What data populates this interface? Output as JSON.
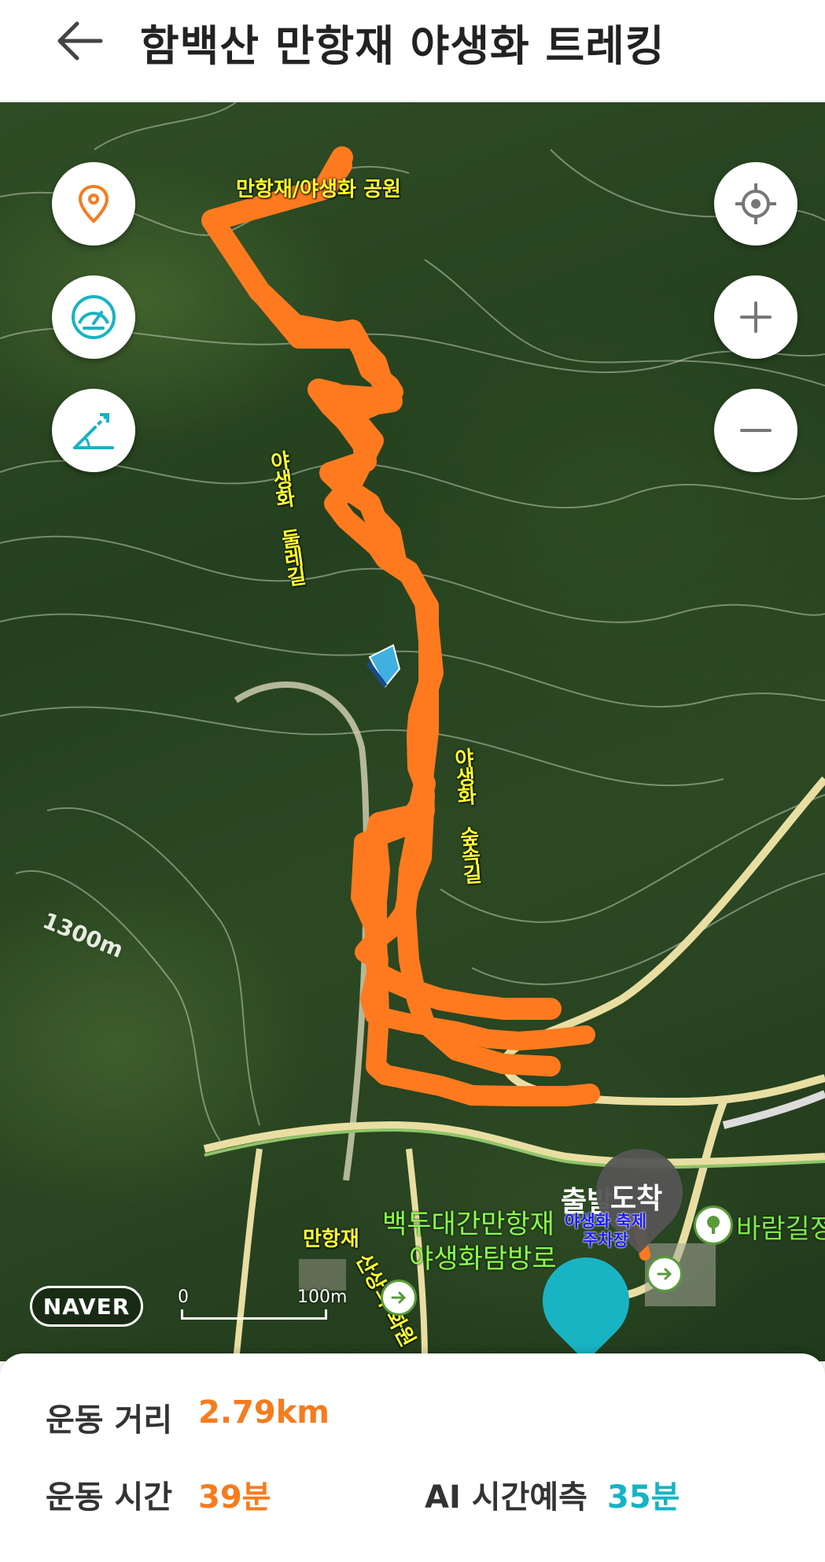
{
  "header": {
    "title": "함백산 만항재 야생화 트레킹"
  },
  "map": {
    "labels": {
      "park": "만항재/야생화 공원",
      "dulle": "야생화 둘레길",
      "forest": "야생화 숲속길",
      "garden": "산상의 화원",
      "manhangjae": "만항재",
      "parking": "야생화 축제\n주차장",
      "contour": "1300m",
      "baekdu1": "백두대간만항재",
      "baekdu2": "야생화탐방로",
      "baram": "바람길정"
    },
    "markers": {
      "start": "출발",
      "end": "도착"
    },
    "logo": "NAVER",
    "scale": {
      "zero": "0",
      "hundred": "100m"
    }
  },
  "stats": {
    "distance_label": "운동 거리",
    "distance_value": "2.79km",
    "time_label": "운동 시간",
    "time_value": "39분",
    "ai_label": "AI 시간예측",
    "ai_value": "35분"
  },
  "colors": {
    "route": "#ff7a1f",
    "accent_orange": "#f57c1f",
    "accent_teal": "#17b3c4"
  }
}
